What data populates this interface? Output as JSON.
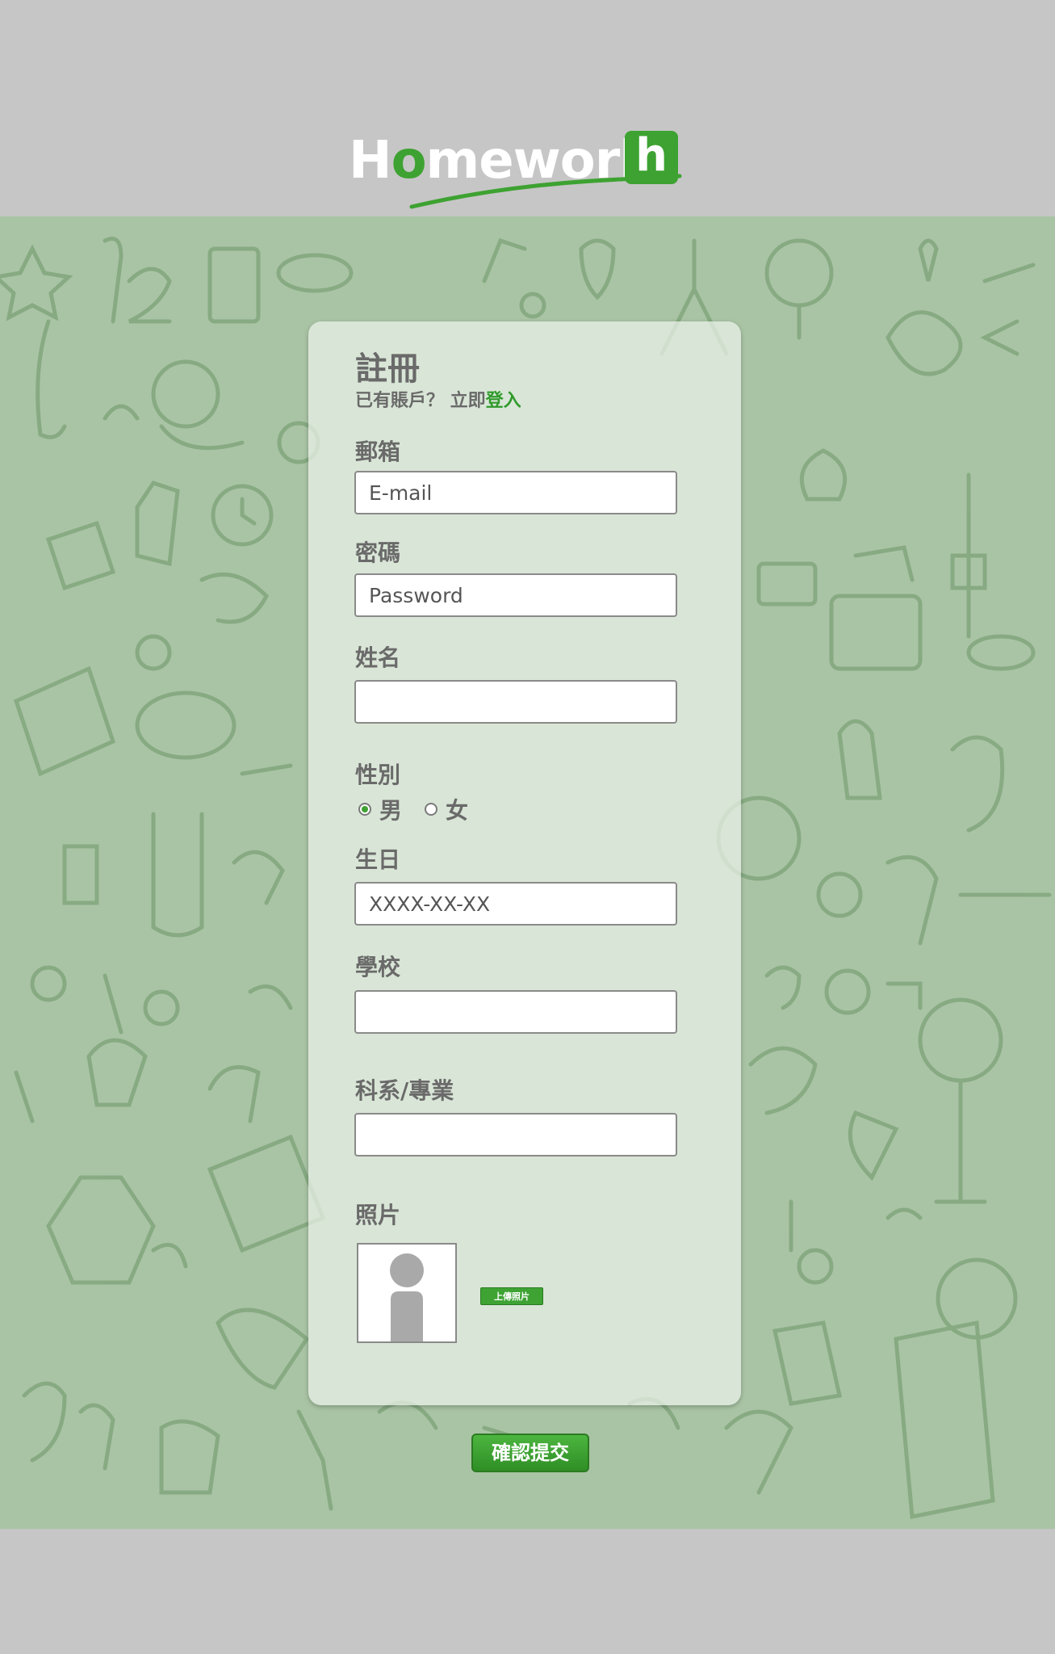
{
  "brand": {
    "logo_word": "Homework",
    "logo_letter": "h",
    "accent_color": "#3da231"
  },
  "form": {
    "title": "註冊",
    "subtitle_prefix": "已有賬戶？ 立即",
    "subtitle_link": "登入",
    "email": {
      "label": "郵箱",
      "placeholder": "E-mail"
    },
    "password": {
      "label": "密碼",
      "placeholder": "Password"
    },
    "name": {
      "label": "姓名",
      "placeholder": ""
    },
    "gender": {
      "label": "性別",
      "options": [
        "男",
        "女"
      ],
      "selected": "男"
    },
    "birthday": {
      "label": "生日",
      "placeholder": "XXXX-XX-XX"
    },
    "school": {
      "label": "學校",
      "placeholder": ""
    },
    "department": {
      "label": "科系/專業",
      "placeholder": ""
    },
    "photo": {
      "label": "照片",
      "upload_label": "上傳照片",
      "avatar_icon": "person-silhouette-icon"
    },
    "submit_label": "確認提交"
  }
}
